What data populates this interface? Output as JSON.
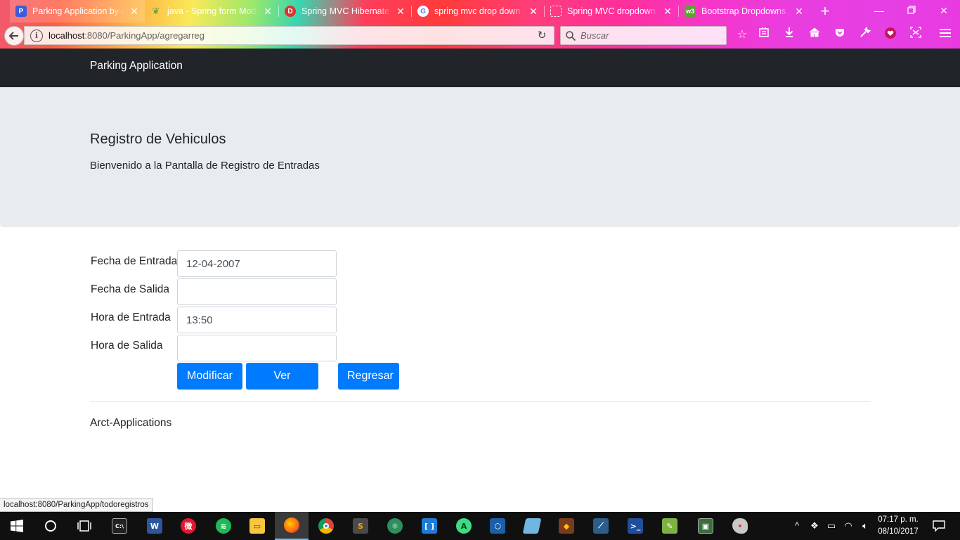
{
  "browser": {
    "tabs": [
      {
        "label": "Parking Application by A",
        "favicon": "#3b5bdb",
        "active": true
      },
      {
        "label": "java - Spring form Mode",
        "favicon": "#6ba539",
        "active": false
      },
      {
        "label": "Spring MVC Hibernate M",
        "favicon": "#e03131",
        "active": false
      },
      {
        "label": "spring mvc drop down li",
        "favicon": "#4285f4",
        "active": false
      },
      {
        "label": "Spring MVC dropdown b",
        "favicon": "#ffffff",
        "active": false
      },
      {
        "label": "Bootstrap Dropdowns",
        "favicon": "#5ba432",
        "active": false
      }
    ],
    "url_host": "localhost",
    "url_path": ":8080/ParkingApp/agregarreg",
    "search_placeholder": "Buscar",
    "status_link": "localhost:8080/ParkingApp/todoregistros"
  },
  "page": {
    "brand": "Parking Application",
    "title": "Registro de Vehiculos",
    "lead": "Bienvenido a la Pantalla de Registro de Entradas",
    "form": {
      "fecha_entrada_label": "Fecha de Entrada",
      "fecha_entrada_value": "12-04-2007",
      "fecha_salida_label": "Fecha de Salida",
      "fecha_salida_value": "",
      "hora_entrada_label": "Hora de Entrada",
      "hora_entrada_value": "13:50",
      "hora_salida_label": "Hora de Salida",
      "hora_salida_value": ""
    },
    "buttons": {
      "modificar": "Modificar",
      "ver_listado": "Ver Listado",
      "regresar": "Regresar"
    },
    "footer": "Arct-Applications",
    "colors": {
      "primary": "#007bff",
      "navbar": "#212529",
      "jumbotron": "#e9ecef"
    }
  },
  "taskbar": {
    "clock_time": "07:17 p. m.",
    "clock_date": "08/10/2017"
  }
}
